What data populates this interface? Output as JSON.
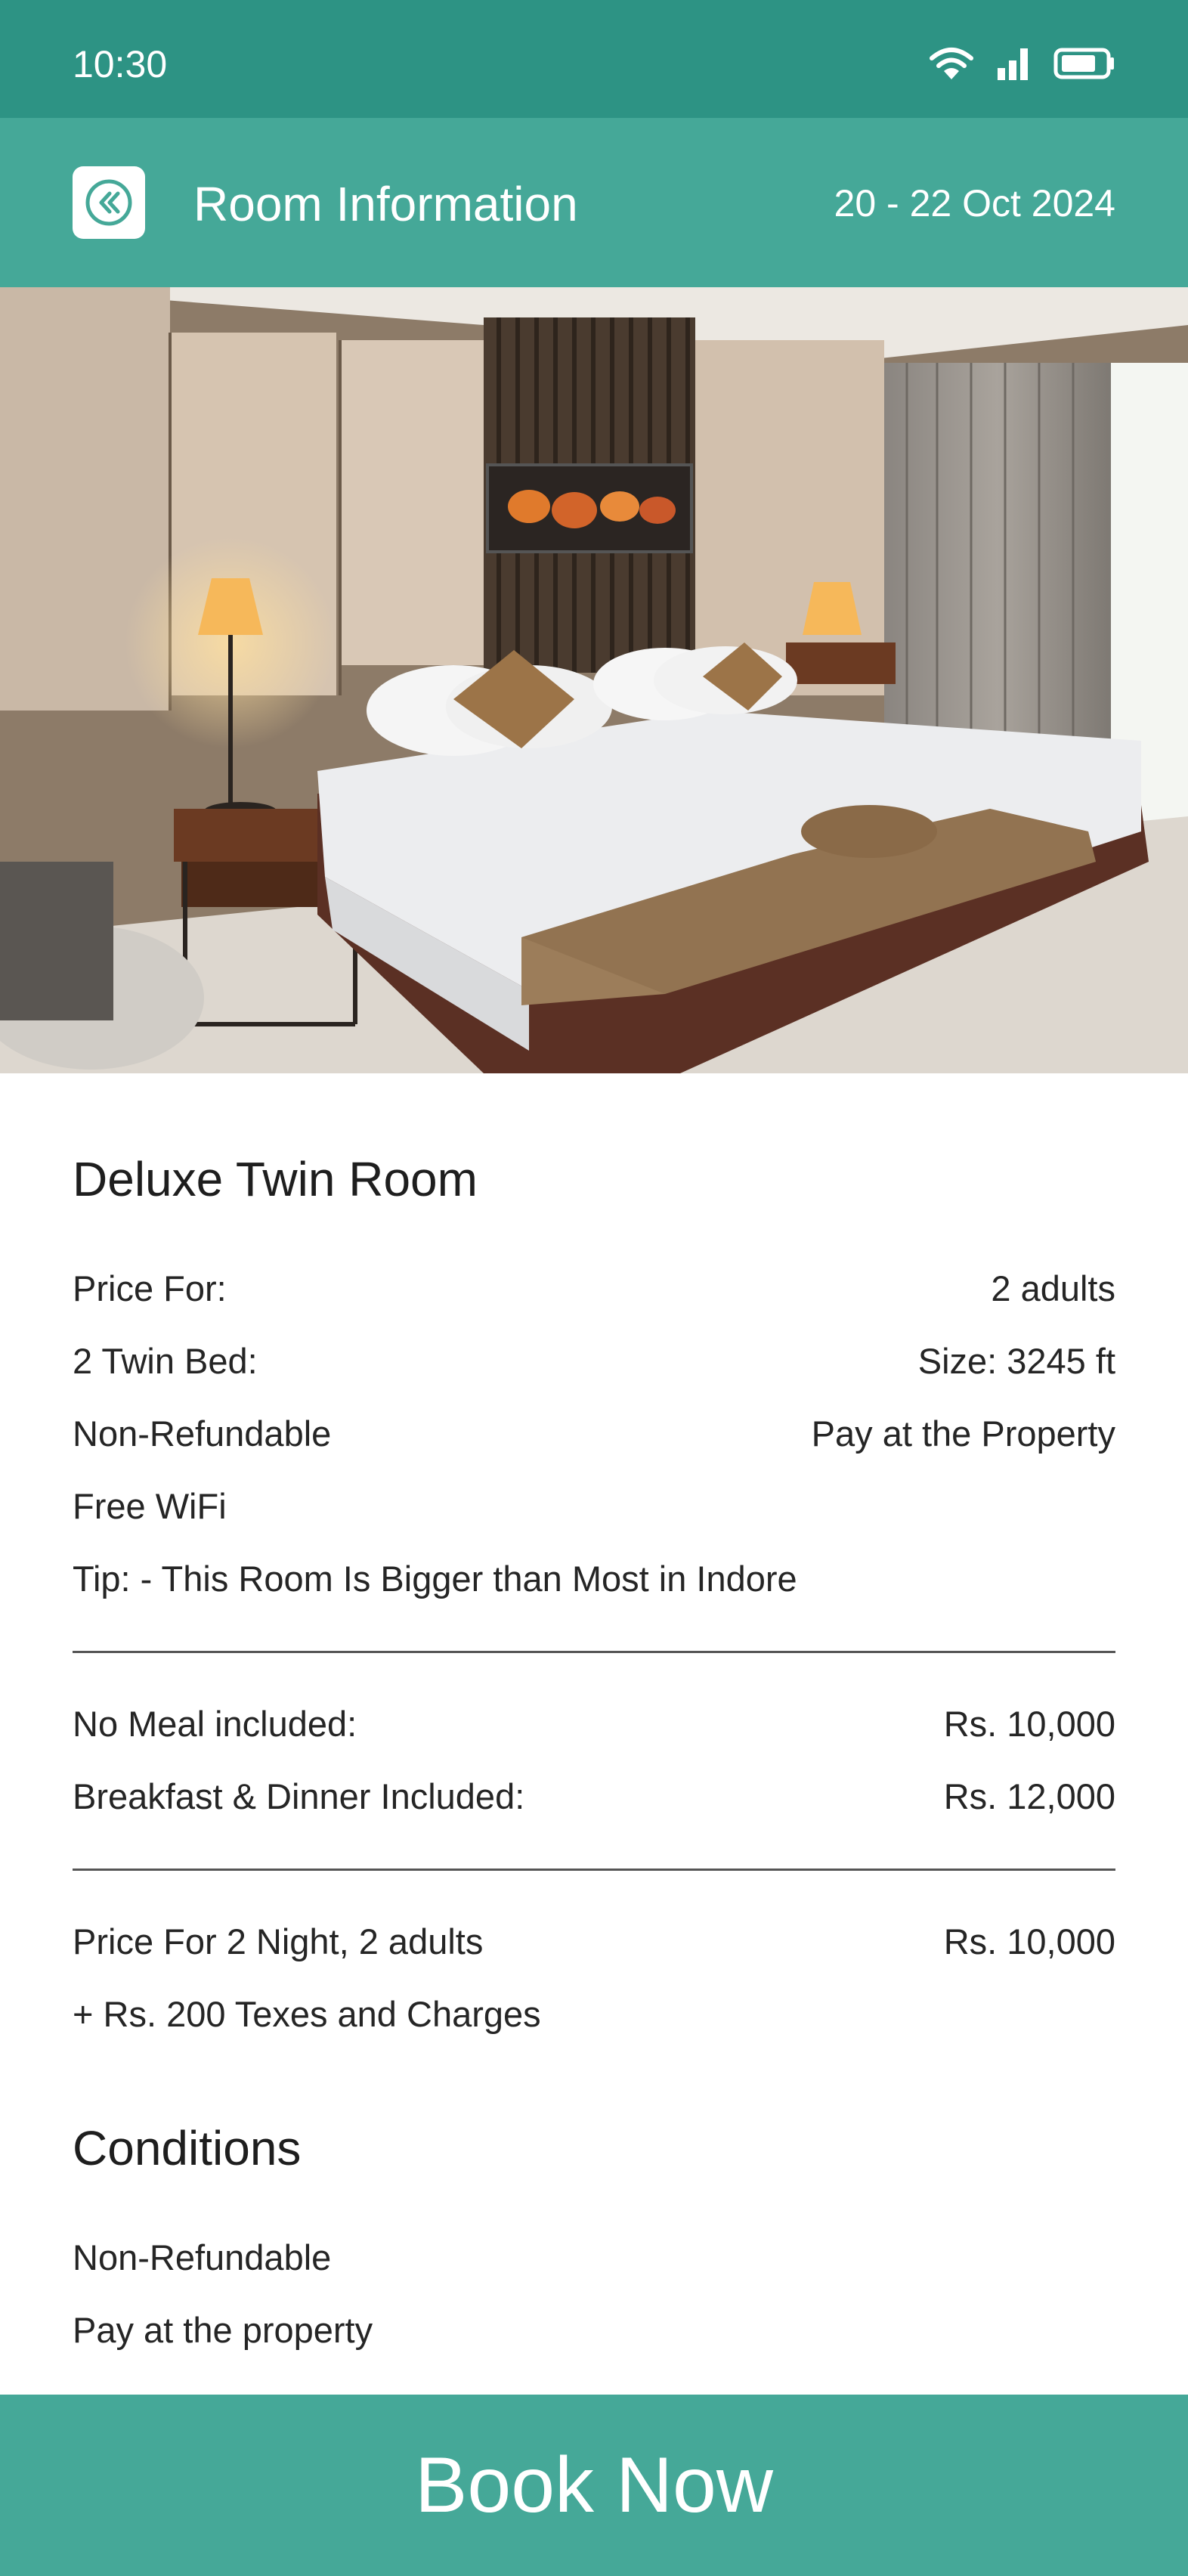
{
  "status_bar": {
    "time": "10:30",
    "icons": [
      "wifi-icon",
      "signal-icon",
      "battery-icon"
    ]
  },
  "app_bar": {
    "back_icon": "double-chevron-left-icon",
    "title": "Room Information",
    "dates": "20 - 22 Oct 2024"
  },
  "room": {
    "photo": "hotel-room-bed-photo",
    "name": "Deluxe Twin Room",
    "details": {
      "price_for_label": "Price For:",
      "price_for_value": "2 adults",
      "beds": "2 Twin Bed:",
      "size": "Size: 3245 ft",
      "refund": "Non-Refundable",
      "payment": "Pay at the Property",
      "wifi": "Free WiFi",
      "tip": "Tip: - This Room Is Bigger than Most in Indore"
    },
    "meals": [
      {
        "label": "No Meal included:",
        "price": "Rs. 10,000"
      },
      {
        "label": "Breakfast & Dinner Included:",
        "price": "Rs. 12,000"
      }
    ],
    "total": {
      "label": "Price For 2 Night, 2 adults",
      "price": "Rs. 10,000",
      "taxes": "+ Rs. 200 Texes and Charges"
    }
  },
  "conditions": {
    "title": "Conditions",
    "items": [
      "Non-Refundable",
      "Pay at the property"
    ]
  },
  "book_button": "Book Now",
  "colors": {
    "status_bar": "#2d9384",
    "accent": "#45a898",
    "text": "#222222"
  }
}
